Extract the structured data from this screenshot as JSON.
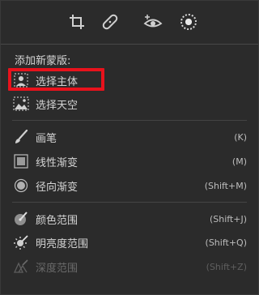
{
  "colors": {
    "panel_bg": "#2b2b2b",
    "text": "#d4d4d4",
    "disabled_text": "#6a6a6a",
    "highlight": "#e8121c"
  },
  "toolbar": {
    "tools": [
      {
        "name": "crop-icon"
      },
      {
        "name": "heal-icon"
      },
      {
        "name": "red-eye-icon"
      },
      {
        "name": "mask-icon",
        "active": true
      }
    ]
  },
  "menu": {
    "title": "添加新蒙版:",
    "items": [
      {
        "label": "选择主体",
        "shortcut": "",
        "icon": "subject-icon"
      },
      {
        "label": "选择天空",
        "shortcut": "",
        "icon": "sky-icon"
      },
      {
        "label": "画笔",
        "shortcut": "(K)",
        "icon": "brush-icon"
      },
      {
        "label": "线性渐变",
        "shortcut": "(M)",
        "icon": "linear-gradient-icon"
      },
      {
        "label": "径向渐变",
        "shortcut": "(Shift+M)",
        "icon": "radial-gradient-icon"
      },
      {
        "label": "颜色范围",
        "shortcut": "(Shift+J)",
        "icon": "color-range-icon"
      },
      {
        "label": "明亮度范围",
        "shortcut": "(Shift+Q)",
        "icon": "luminance-range-icon"
      },
      {
        "label": "深度范围",
        "shortcut": "(Shift+Z)",
        "icon": "depth-range-icon",
        "disabled": true
      }
    ]
  }
}
